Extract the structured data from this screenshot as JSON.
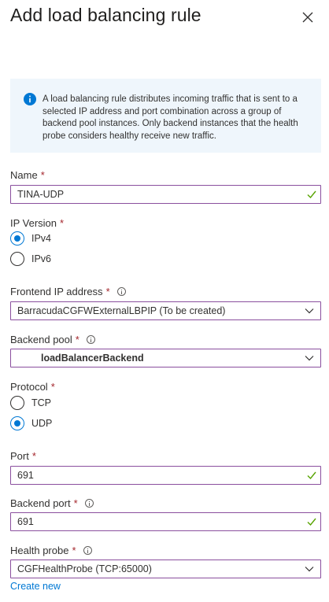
{
  "panel": {
    "title": "Add load balancing rule",
    "close_icon": "close-icon"
  },
  "info": {
    "icon": "info-icon",
    "text": "A load balancing rule distributes incoming traffic that is sent to a selected IP address and port combination across a group of backend pool instances. Only backend instances that the health probe considers healthy receive new traffic."
  },
  "name": {
    "label": "Name",
    "required": "*",
    "value": "TINA-UDP"
  },
  "ip_version": {
    "label": "IP Version",
    "required": "*",
    "options": [
      "IPv4",
      "IPv6"
    ],
    "selected": "IPv4"
  },
  "frontend_ip": {
    "label": "Frontend IP address",
    "required": "*",
    "value": "BarracudaCGFWExternalLBPIP (To be created)"
  },
  "backend_pool": {
    "label": "Backend pool",
    "required": "*",
    "value": "loadBalancerBackend"
  },
  "protocol": {
    "label": "Protocol",
    "required": "*",
    "options": [
      "TCP",
      "UDP"
    ],
    "selected": "UDP"
  },
  "port": {
    "label": "Port",
    "required": "*",
    "value": "691"
  },
  "backend_port": {
    "label": "Backend port",
    "required": "*",
    "value": "691"
  },
  "health_probe": {
    "label": "Health probe",
    "required": "*",
    "value": "CGFHealthProbe (TCP:65000)",
    "create_new": "Create new"
  },
  "colors": {
    "accent": "#0078d4",
    "field_border": "#8a4f9e",
    "valid_check": "#57a300",
    "required": "#a4262c",
    "info_bg": "#eff6fc"
  }
}
